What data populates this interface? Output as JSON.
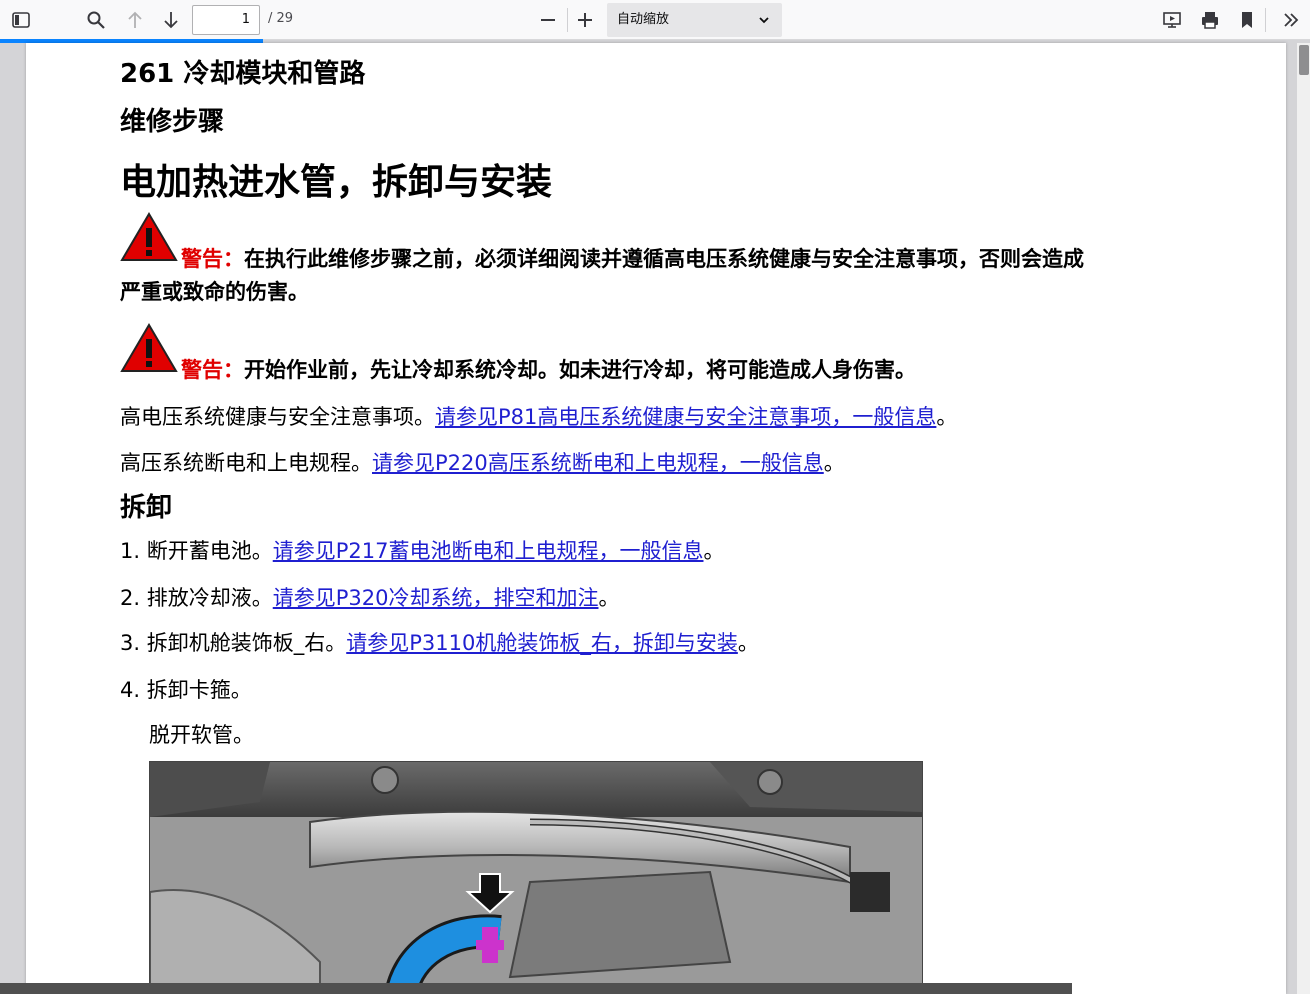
{
  "toolbar": {
    "page_current": "1",
    "page_total": "/ 29",
    "zoom_value": "自动缩放"
  },
  "doc": {
    "section_heading": "261 冷却模块和管路",
    "sub_heading": "维修步骤",
    "title": "电加热进水管，拆卸与安装",
    "warnings": [
      {
        "label": "警告：",
        "line1": "在执行此维修步骤之前，必须详细阅读并遵循高电压系统健康与安全注意事项，否则会造成",
        "line2": "严重或致命的伤害。"
      },
      {
        "label": "警告：",
        "line1": "开始作业前，先让冷却系统冷却。如未进行冷却，将可能造成人身伤害。",
        "line2": ""
      }
    ],
    "refs": [
      {
        "prefix": "高电压系统健康与安全注意事项。",
        "link": "请参见P81高电压系统健康与安全注意事项，一般信息",
        "suffix": "。"
      },
      {
        "prefix": "高压系统断电和上电规程。",
        "link": "请参见P220高压系统断电和上电规程，一般信息",
        "suffix": "。"
      }
    ],
    "removal_heading": "拆卸",
    "steps": [
      {
        "num": "1.",
        "text": "断开蓄电池。",
        "link": "请参见P217蓄电池断电和上电规程，一般信息",
        "suffix": "。"
      },
      {
        "num": "2.",
        "text": "排放冷却液。",
        "link": "请参见P320冷却系统，排空和加注",
        "suffix": "。"
      },
      {
        "num": "3.",
        "text": "拆卸机舱装饰板_右。",
        "link": "请参见P3110机舱装饰板_右，拆卸与安装",
        "suffix": "。"
      },
      {
        "num": "4.",
        "text": "拆卸卡箍。",
        "link": "",
        "suffix": ""
      }
    ],
    "step4_sub": "脱开软管。"
  },
  "colors": {
    "accent": "#0a84ff",
    "link": "#1f1fd0",
    "warning": "#e00000"
  }
}
